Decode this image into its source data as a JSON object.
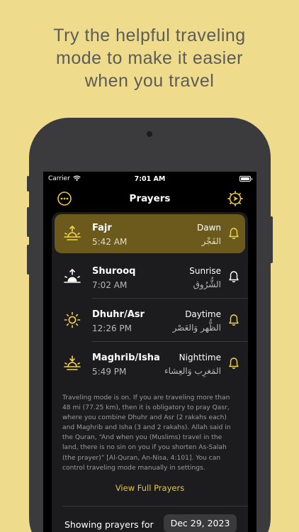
{
  "headline": {
    "line1": "Try the helpful traveling",
    "line2": "mode to make it easier",
    "line3": "when you travel"
  },
  "status_bar": {
    "carrier": "Carrier",
    "time": "7:01 AM"
  },
  "nav": {
    "title": "Prayers",
    "left_icon": "more-icon",
    "right_icon": "travel-compass-icon"
  },
  "colors": {
    "background": "#eedb8c",
    "accent": "#e7c63c",
    "active_row": "#6b5a1b"
  },
  "prayers": [
    {
      "name": "Fajr",
      "time": "5:42 AM",
      "period": "Dawn",
      "arabic": "الفَجْر",
      "icon": "dawn-icon",
      "active": true
    },
    {
      "name": "Shurooq",
      "time": "7:02 AM",
      "period": "Sunrise",
      "arabic": "الشُّرُوق",
      "icon": "sunrise-icon",
      "active": false
    },
    {
      "name": "Dhuhr/Asr",
      "time": "12:26 PM",
      "period": "Daytime",
      "arabic": "الظُّهر وَالعَصْر",
      "icon": "sun-icon",
      "active": false
    },
    {
      "name": "Maghrib/Isha",
      "time": "5:49 PM",
      "period": "Nighttime",
      "arabic": "المَغرِب وَالعِشاء",
      "icon": "sunset-icon",
      "active": false
    }
  ],
  "info_text": "Traveling mode is on. If you are traveling more than 48 mi (77.25 km), then it is obligatory to pray Qasr, where you combine Dhuhr and Asr (2 rakahs each) and Maghrib and Isha (3 and 2 rakahs). Allah said in the Quran, “And when you (Muslims) travel in the land, there is no sin on you if you shorten As-Salah (the prayer)” [Al-Quran, An-Nisa, 4:101]. You can control traveling mode manually in settings.",
  "view_full_label": "View Full Prayers",
  "showing_label": "Showing prayers for",
  "date": "Dec 29, 2023"
}
